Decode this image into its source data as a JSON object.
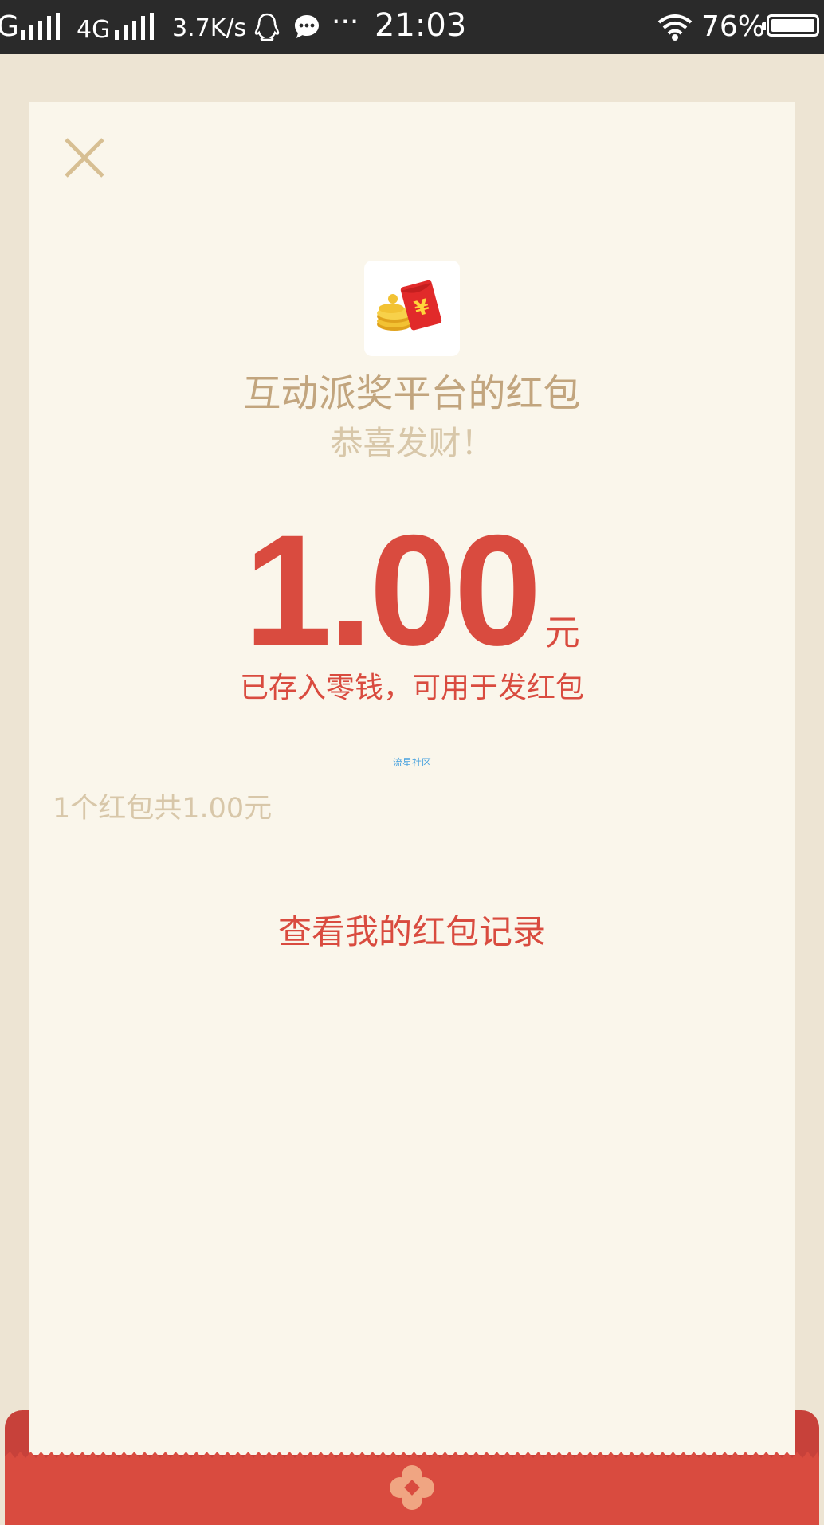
{
  "status_bar": {
    "network_prefix": "G",
    "network_type": "4G",
    "speed": "3.7K/s",
    "more": "···",
    "time": "21:03",
    "battery_percent": "76%"
  },
  "red_packet": {
    "sender_title": "互动派奖平台的红包",
    "greeting": "恭喜发财！",
    "amount": "1.00",
    "currency_unit": "元",
    "stored_note": "已存入零钱，可用于发红包",
    "watermark": "流星社区",
    "summary": "1个红包共1.00元",
    "view_records": "查看我的红包记录"
  },
  "colors": {
    "accent_red": "#d94b3f",
    "gold_text": "#c2a57e",
    "card_bg": "#faf6eb"
  },
  "icons": [
    "signal-icon",
    "qq-icon",
    "chat-icon",
    "wifi-icon",
    "battery-icon",
    "close-icon",
    "red-packet-logo",
    "pocket-flower-icon"
  ]
}
